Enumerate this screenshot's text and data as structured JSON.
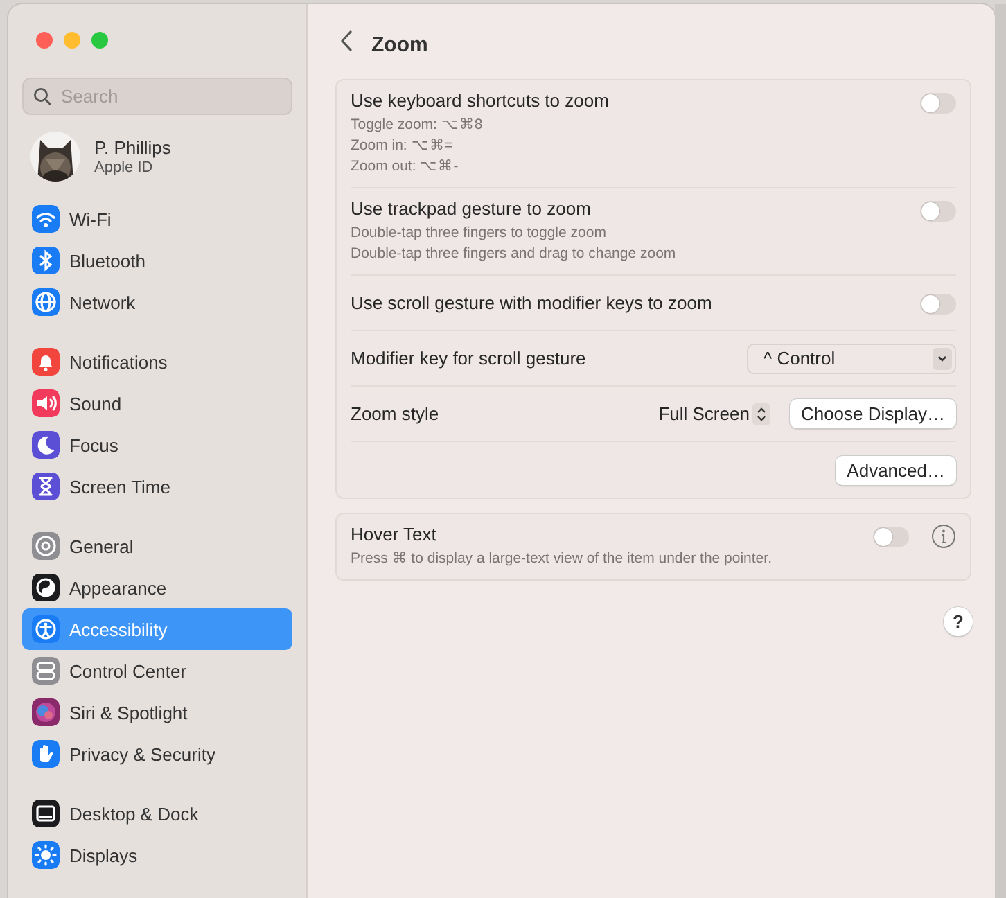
{
  "sidebar": {
    "search": {
      "placeholder": "Search"
    },
    "account": {
      "name": "P. Phillips",
      "subtitle": "Apple ID"
    },
    "groups": [
      {
        "items": [
          {
            "label": "Wi-Fi",
            "color": "#1a7cf5",
            "selected": false
          },
          {
            "label": "Bluetooth",
            "color": "#1a7cf5",
            "selected": false
          },
          {
            "label": "Network",
            "color": "#1a7cf5",
            "selected": false
          }
        ]
      },
      {
        "items": [
          {
            "label": "Notifications",
            "color": "#f2453d",
            "selected": false
          },
          {
            "label": "Sound",
            "color": "#f23a5c",
            "selected": false
          },
          {
            "label": "Focus",
            "color": "#5b4fd6",
            "selected": false
          },
          {
            "label": "Screen Time",
            "color": "#5b4fd6",
            "selected": false
          }
        ]
      },
      {
        "items": [
          {
            "label": "General",
            "color": "#8e8e93",
            "selected": false
          },
          {
            "label": "Appearance",
            "color": "#1c1c1e",
            "selected": false
          },
          {
            "label": "Accessibility",
            "color": "#1a7cf5",
            "selected": true
          },
          {
            "label": "Control Center",
            "color": "#8e8e93",
            "selected": false
          },
          {
            "label": "Siri & Spotlight",
            "color": "#8a2a6a",
            "selected": false
          },
          {
            "label": "Privacy & Security",
            "color": "#1a7cf5",
            "selected": false
          }
        ]
      },
      {
        "items": [
          {
            "label": "Desktop & Dock",
            "color": "#1c1c1e",
            "selected": false
          },
          {
            "label": "Displays",
            "color": "#1a7cf5",
            "selected": false
          }
        ]
      }
    ]
  },
  "page": {
    "title": "Zoom",
    "cards": [
      {
        "rows": [
          {
            "kind": "toggle",
            "label": "Use keyboard shortcuts to zoom",
            "details": [
              "Toggle zoom: ⌥⌘8",
              "Zoom in: ⌥⌘=",
              "Zoom out: ⌥⌘-"
            ],
            "on": false
          },
          {
            "kind": "toggle",
            "label": "Use trackpad gesture to zoom",
            "details": [
              "Double-tap three fingers to toggle zoom",
              "Double-tap three fingers and drag to change zoom"
            ],
            "on": false
          },
          {
            "kind": "toggle",
            "label": "Use scroll gesture with modifier keys to zoom",
            "on": false
          },
          {
            "kind": "popup",
            "label": "Modifier key for scroll gesture",
            "value": "^ Control"
          },
          {
            "kind": "style",
            "label": "Zoom style",
            "value": "Full Screen",
            "button": "Choose Display…"
          },
          {
            "kind": "button",
            "button": "Advanced…"
          }
        ]
      },
      {
        "rows": [
          {
            "kind": "toggle",
            "label": "Hover Text",
            "details": [
              "Press ⌘ to display a large-text view of the item under the pointer."
            ],
            "on": false,
            "info": true
          }
        ]
      }
    ],
    "help": "?"
  }
}
